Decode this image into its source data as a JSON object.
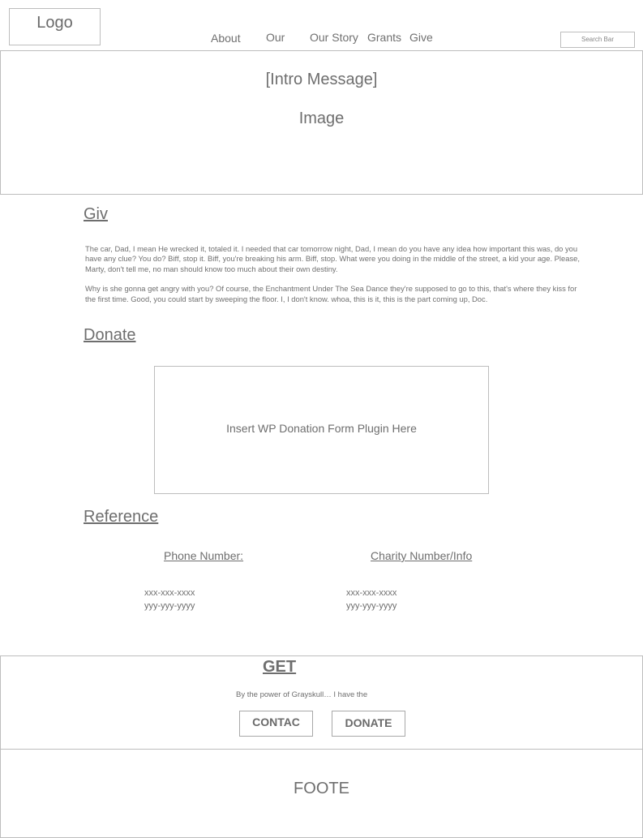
{
  "header": {
    "logo": "Logo",
    "nav": [
      "About",
      "Our",
      "Our Story",
      "Grants",
      "Give"
    ],
    "search_placeholder": "Search Bar"
  },
  "hero": {
    "intro": "[Intro Message]",
    "image": "Image"
  },
  "giv": {
    "heading": "Giv",
    "paragraphs": [
      "The car, Dad, I mean He wrecked it, totaled it. I needed that car tomorrow night, Dad, I mean do you have any idea how important this was, do you have any clue? You do? Biff, stop it. Biff, you're breaking his arm. Biff, stop. What were you doing in the middle of the street, a kid your age. Please, Marty, don't tell me, no man should know too much about their own destiny.",
      "Why is she gonna get angry with you? Of course, the Enchantment Under The Sea Dance they're supposed to go to this, that's where they kiss for the first time. Good, you could start by sweeping the floor. I, I don't know. whoa, this is it, this is the part coming up, Doc."
    ]
  },
  "donate": {
    "heading": "Donate",
    "placeholder": "Insert WP Donation Form Plugin Here"
  },
  "reference": {
    "heading": "Reference",
    "phone": {
      "label": "Phone Number:",
      "lines": [
        "xxx-xxx-xxxx",
        "yyy-yyy-yyyy"
      ]
    },
    "charity": {
      "label": "Charity Number/Info",
      "lines": [
        "xxx-xxx-xxxx",
        "yyy-yyy-yyyy"
      ]
    }
  },
  "get": {
    "heading": "GET",
    "text": "By the power of Grayskull… I have the",
    "contact": "CONTAC",
    "donate": "DONATE"
  },
  "footer": {
    "text": "FOOTE"
  }
}
